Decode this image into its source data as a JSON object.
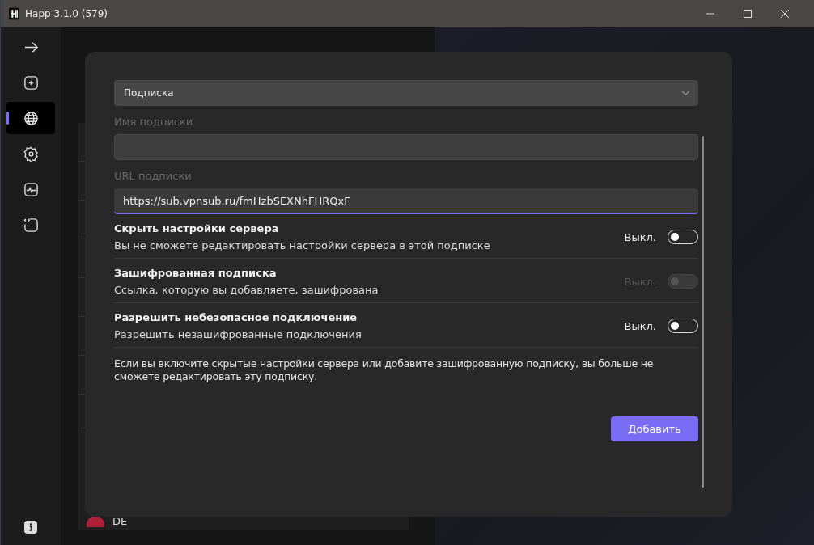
{
  "window": {
    "title": "Happ 3.1.0 (579)"
  },
  "sidebar": {
    "items": [
      {
        "kind": "arrow",
        "selected": false
      },
      {
        "kind": "plus",
        "selected": false
      },
      {
        "kind": "globe",
        "selected": true
      },
      {
        "kind": "gear",
        "selected": false
      },
      {
        "kind": "chart",
        "selected": false
      },
      {
        "kind": "code",
        "selected": false
      }
    ]
  },
  "background": {
    "list_item": "DE"
  },
  "dialog": {
    "type_select": {
      "value": "Подписка"
    },
    "name_field": {
      "label": "Имя подписки"
    },
    "url_field": {
      "label": "URL подписки",
      "value": "https://sub.vpnsub.ru/fmHzbSEXNhFHRQxF"
    },
    "options": [
      {
        "title": "Скрыть настройки сервера",
        "description": "Вы не сможете редактировать настройки сервера в этой подписке",
        "state_label": "Выкл.",
        "on": false,
        "disabled": false
      },
      {
        "title": "Зашифрованная подписка",
        "description": "Ссылка, которую вы добавляете, зашифрована",
        "state_label": "Выкл.",
        "on": false,
        "disabled": true
      },
      {
        "title": "Разрешить небезопасное подключение",
        "description": "Разрешить незашифрованные подключения",
        "state_label": "Выкл.",
        "on": false,
        "disabled": false
      }
    ],
    "note": "Если вы включите скрытые настройки сервера или добавите зашифрованную подписку, вы больше не сможете редактировать эту подписку.",
    "add_button": "Добавить"
  }
}
